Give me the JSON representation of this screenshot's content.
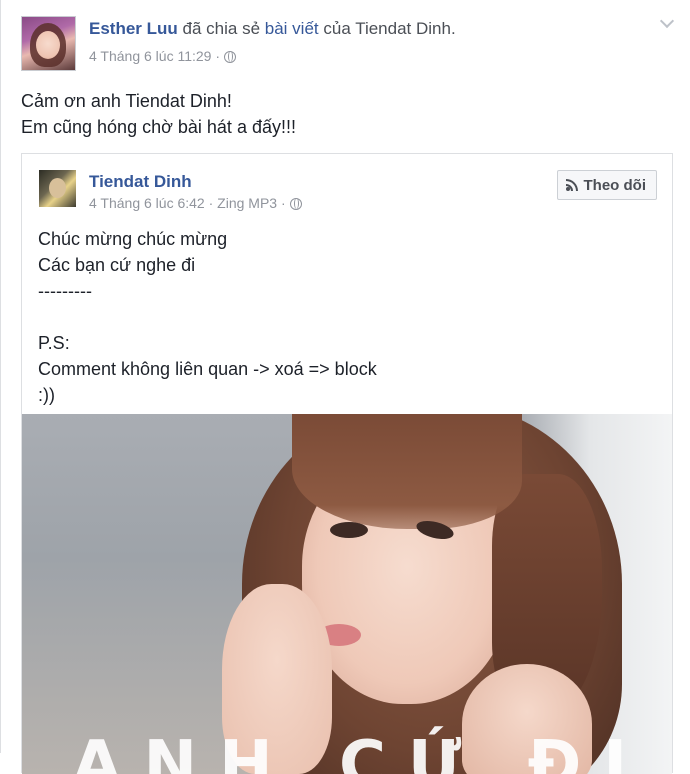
{
  "post": {
    "author": "Esther Luu",
    "action": "đã chia sẻ",
    "object_link": "bài viết",
    "object_suffix": "của Tiendat Dinh.",
    "timestamp": "4 Tháng 6 lúc 11:29",
    "privacy_icon": "globe-icon",
    "menu_icon": "chevron-down-icon",
    "message_lines": [
      "Cảm ơn anh Tiendat Dinh!",
      "Em cũng hóng chờ bài hát a đấy!!!"
    ]
  },
  "shared_post": {
    "author": "Tiendat Dinh",
    "timestamp": "4 Tháng 6 lúc 6:42",
    "source": "Zing MP3",
    "privacy_icon": "globe-icon",
    "follow_label": "Theo dõi",
    "follow_icon": "rss-icon",
    "body_lines": [
      "Chúc mừng chúc mừng",
      "Các bạn cứ nghe đi",
      "---------",
      "",
      "P.S:",
      "Comment không liên quan -> xoá => block",
      ":))"
    ],
    "cover_title": "ANH CỨ ĐI ĐI"
  },
  "colors": {
    "link_blue": "#365899",
    "meta_gray": "#90949c",
    "text": "#1d2129",
    "border": "#dddfe2"
  }
}
